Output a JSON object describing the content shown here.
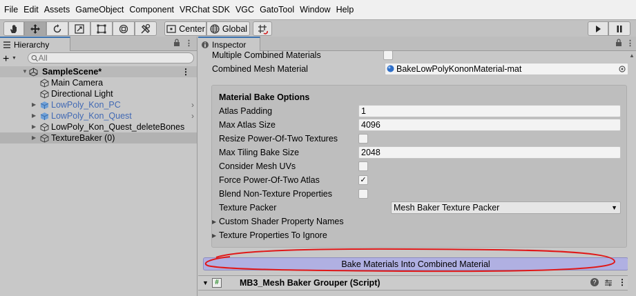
{
  "menu": [
    "File",
    "Edit",
    "Assets",
    "GameObject",
    "Component",
    "VRChat SDK",
    "VGC",
    "GatoTool",
    "Window",
    "Help"
  ],
  "toolbar": {
    "pivot_label": "Center",
    "space_label": "Global"
  },
  "hierarchy": {
    "tab_label": "Hierarchy",
    "search_placeholder": "All",
    "scene_name": "SampleScene*",
    "items": [
      {
        "label": "Main Camera"
      },
      {
        "label": "Directional Light"
      },
      {
        "label": "LowPoly_Kon_PC"
      },
      {
        "label": "LowPoly_Kon_Quest"
      },
      {
        "label": "LowPoly_Kon_Quest_deleteBones"
      },
      {
        "label": "TextureBaker (0)"
      }
    ]
  },
  "inspector": {
    "tab_label": "Inspector",
    "multiple_combined_label": "Multiple Combined Materials",
    "multiple_combined_checked": false,
    "combined_mesh_material_label": "Combined Mesh Material",
    "combined_mesh_material_value": "BakeLowPolyKononMaterial-mat",
    "section_title": "Material Bake Options",
    "atlas_padding_label": "Atlas Padding",
    "atlas_padding_value": "1",
    "max_atlas_size_label": "Max Atlas Size",
    "max_atlas_size_value": "4096",
    "resize_pot_label": "Resize Power-Of-Two Textures",
    "resize_pot_checked": false,
    "max_tiling_label": "Max Tiling Bake Size",
    "max_tiling_value": "2048",
    "consider_uvs_label": "Consider Mesh UVs",
    "consider_uvs_checked": false,
    "force_pot_label": "Force Power-Of-Two Atlas",
    "force_pot_checked": true,
    "force_pot_mark": "✓",
    "blend_label": "Blend Non-Texture Properties",
    "blend_checked": false,
    "texture_packer_label": "Texture Packer",
    "texture_packer_value": "Mesh Baker Texture Packer",
    "custom_shader_label": "Custom Shader Property Names",
    "texture_ignore_label": "Texture Properties To Ignore",
    "bake_button_label": "Bake Materials Into Combined Material",
    "component_title": "MB3_Mesh Baker Grouper (Script)",
    "component_script_icon": "#"
  },
  "colors": {
    "prefab_text": "#4169b4",
    "bake_button": "#b0b0e2",
    "annotation": "#e01818",
    "tab_accent": "#3a72b0"
  }
}
